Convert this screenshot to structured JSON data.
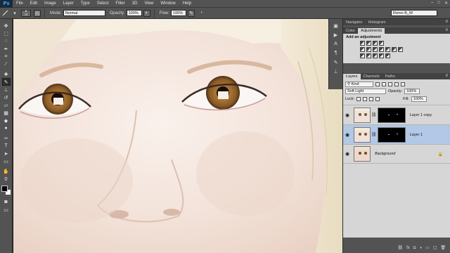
{
  "app": {
    "logo": "Ps"
  },
  "menu": [
    "File",
    "Edit",
    "Image",
    "Layer",
    "Type",
    "Select",
    "Filter",
    "3D",
    "View",
    "Window",
    "Help"
  ],
  "window_controls": [
    "–",
    "□",
    "✕"
  ],
  "options_bar": {
    "brush_size": "45",
    "mode_label": "Mode:",
    "mode_value": "Normal",
    "opacity_label": "Opacity:",
    "opacity_value": "100%",
    "flow_label": "Flow:",
    "flow_value": "100%",
    "workspace": "Remo B_W"
  },
  "panels": {
    "top_tabs": [
      "Navigator",
      "Histogram"
    ],
    "mid_tabs": [
      "Color",
      "Adjustments"
    ],
    "adjustments_title": "Add an adjustment",
    "layer_tabs": [
      "Layers",
      "Channels",
      "Paths"
    ],
    "kind_value": "Kind",
    "blend_mode": "Soft Light",
    "opacity_label": "Opacity:",
    "opacity_value": "100%",
    "lock_label": "Lock:",
    "fill_label": "Fill:",
    "fill_value": "100%"
  },
  "layers": [
    {
      "name": "Layer 1 copy",
      "visible": true,
      "selected": false,
      "has_mask": true
    },
    {
      "name": "Layer 1",
      "visible": true,
      "selected": true,
      "has_mask": true
    },
    {
      "name": "Background",
      "visible": true,
      "selected": false,
      "has_mask": false,
      "locked": true
    }
  ],
  "icons": {
    "eye": "eye-icon",
    "lock": "lock-icon",
    "chain": "chain-link-icon"
  },
  "colors": {
    "foreground": "#000000",
    "background": "#ffffff",
    "selection": "#b2c8e6",
    "ui_dark": "#535353",
    "accent_ps": "#3fa0ff"
  }
}
